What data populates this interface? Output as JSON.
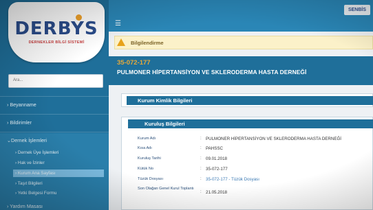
{
  "logo": {
    "text": "DERBYS",
    "subtitle": "DERNEKLER BİLGİ SİSTEMİ"
  },
  "topbar": {
    "menu_icon": "hamburger-icon",
    "brand_badge": "SENBİS"
  },
  "search": {
    "placeholder": "Ara..."
  },
  "sidebar": {
    "items": [
      {
        "label": "› Beyanname"
      },
      {
        "label": "› Bildirimler"
      },
      {
        "label": "⌄Dernek İşlemleri"
      },
      {
        "label": "› Yardım Masası"
      }
    ],
    "subitems": [
      {
        "label": "› Dernek Üye İşlemleri"
      },
      {
        "label": "› Hak ve İzinler"
      },
      {
        "label": "› Kurum Ana Sayfası",
        "active": true
      },
      {
        "label": "› Taşıt Bilgileri"
      },
      {
        "label": "› Yetki Belgesi Formu"
      }
    ]
  },
  "alert": {
    "text": "Bilgilendirme",
    "icon": "warning-icon",
    "color": "#e7a21b"
  },
  "header": {
    "code": "35-072-177",
    "title": "PULMONER HİPERTANSİYON VE SKLERODERMA HASTA DERNEĞİ"
  },
  "panels": {
    "identity_title": "Kurum Kimlik Bilgileri",
    "establish_title": "Kuruluş Bilgileri"
  },
  "fields": [
    {
      "label": "Kurum Adı",
      "value": "PULMONER HİPERTANSİYON VE SKLERODERMA HASTA DERNEĞİ"
    },
    {
      "label": "Kısa Adı",
      "value": "PAHSSC"
    },
    {
      "label": "Kuruluş Tarihi",
      "value": "09.01.2018"
    },
    {
      "label": "Kütük No",
      "value": "35-072-177"
    },
    {
      "label": "Tüzük Dosyası",
      "value": "35-072-177 - Tüzük Dosyası",
      "link": true
    },
    {
      "label": "Son Olağan Genel Kurul Toplantı",
      "value": "21.05.2018"
    }
  ],
  "colors": {
    "sidebar": "#1f6f9a",
    "topbar": "#2a86b6",
    "accent": "#e6a93a",
    "alert_bg": "#fbf1c9"
  }
}
